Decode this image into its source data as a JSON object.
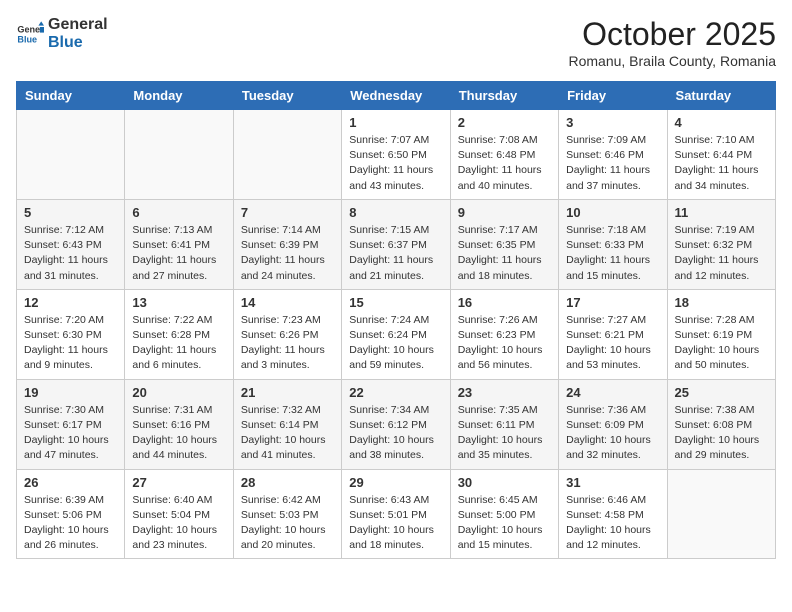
{
  "header": {
    "logo_general": "General",
    "logo_blue": "Blue",
    "month_title": "October 2025",
    "location": "Romanu, Braila County, Romania"
  },
  "weekdays": [
    "Sunday",
    "Monday",
    "Tuesday",
    "Wednesday",
    "Thursday",
    "Friday",
    "Saturday"
  ],
  "weeks": [
    [
      {
        "day": "",
        "info": ""
      },
      {
        "day": "",
        "info": ""
      },
      {
        "day": "",
        "info": ""
      },
      {
        "day": "1",
        "info": "Sunrise: 7:07 AM\nSunset: 6:50 PM\nDaylight: 11 hours\nand 43 minutes."
      },
      {
        "day": "2",
        "info": "Sunrise: 7:08 AM\nSunset: 6:48 PM\nDaylight: 11 hours\nand 40 minutes."
      },
      {
        "day": "3",
        "info": "Sunrise: 7:09 AM\nSunset: 6:46 PM\nDaylight: 11 hours\nand 37 minutes."
      },
      {
        "day": "4",
        "info": "Sunrise: 7:10 AM\nSunset: 6:44 PM\nDaylight: 11 hours\nand 34 minutes."
      }
    ],
    [
      {
        "day": "5",
        "info": "Sunrise: 7:12 AM\nSunset: 6:43 PM\nDaylight: 11 hours\nand 31 minutes."
      },
      {
        "day": "6",
        "info": "Sunrise: 7:13 AM\nSunset: 6:41 PM\nDaylight: 11 hours\nand 27 minutes."
      },
      {
        "day": "7",
        "info": "Sunrise: 7:14 AM\nSunset: 6:39 PM\nDaylight: 11 hours\nand 24 minutes."
      },
      {
        "day": "8",
        "info": "Sunrise: 7:15 AM\nSunset: 6:37 PM\nDaylight: 11 hours\nand 21 minutes."
      },
      {
        "day": "9",
        "info": "Sunrise: 7:17 AM\nSunset: 6:35 PM\nDaylight: 11 hours\nand 18 minutes."
      },
      {
        "day": "10",
        "info": "Sunrise: 7:18 AM\nSunset: 6:33 PM\nDaylight: 11 hours\nand 15 minutes."
      },
      {
        "day": "11",
        "info": "Sunrise: 7:19 AM\nSunset: 6:32 PM\nDaylight: 11 hours\nand 12 minutes."
      }
    ],
    [
      {
        "day": "12",
        "info": "Sunrise: 7:20 AM\nSunset: 6:30 PM\nDaylight: 11 hours\nand 9 minutes."
      },
      {
        "day": "13",
        "info": "Sunrise: 7:22 AM\nSunset: 6:28 PM\nDaylight: 11 hours\nand 6 minutes."
      },
      {
        "day": "14",
        "info": "Sunrise: 7:23 AM\nSunset: 6:26 PM\nDaylight: 11 hours\nand 3 minutes."
      },
      {
        "day": "15",
        "info": "Sunrise: 7:24 AM\nSunset: 6:24 PM\nDaylight: 10 hours\nand 59 minutes."
      },
      {
        "day": "16",
        "info": "Sunrise: 7:26 AM\nSunset: 6:23 PM\nDaylight: 10 hours\nand 56 minutes."
      },
      {
        "day": "17",
        "info": "Sunrise: 7:27 AM\nSunset: 6:21 PM\nDaylight: 10 hours\nand 53 minutes."
      },
      {
        "day": "18",
        "info": "Sunrise: 7:28 AM\nSunset: 6:19 PM\nDaylight: 10 hours\nand 50 minutes."
      }
    ],
    [
      {
        "day": "19",
        "info": "Sunrise: 7:30 AM\nSunset: 6:17 PM\nDaylight: 10 hours\nand 47 minutes."
      },
      {
        "day": "20",
        "info": "Sunrise: 7:31 AM\nSunset: 6:16 PM\nDaylight: 10 hours\nand 44 minutes."
      },
      {
        "day": "21",
        "info": "Sunrise: 7:32 AM\nSunset: 6:14 PM\nDaylight: 10 hours\nand 41 minutes."
      },
      {
        "day": "22",
        "info": "Sunrise: 7:34 AM\nSunset: 6:12 PM\nDaylight: 10 hours\nand 38 minutes."
      },
      {
        "day": "23",
        "info": "Sunrise: 7:35 AM\nSunset: 6:11 PM\nDaylight: 10 hours\nand 35 minutes."
      },
      {
        "day": "24",
        "info": "Sunrise: 7:36 AM\nSunset: 6:09 PM\nDaylight: 10 hours\nand 32 minutes."
      },
      {
        "day": "25",
        "info": "Sunrise: 7:38 AM\nSunset: 6:08 PM\nDaylight: 10 hours\nand 29 minutes."
      }
    ],
    [
      {
        "day": "26",
        "info": "Sunrise: 6:39 AM\nSunset: 5:06 PM\nDaylight: 10 hours\nand 26 minutes."
      },
      {
        "day": "27",
        "info": "Sunrise: 6:40 AM\nSunset: 5:04 PM\nDaylight: 10 hours\nand 23 minutes."
      },
      {
        "day": "28",
        "info": "Sunrise: 6:42 AM\nSunset: 5:03 PM\nDaylight: 10 hours\nand 20 minutes."
      },
      {
        "day": "29",
        "info": "Sunrise: 6:43 AM\nSunset: 5:01 PM\nDaylight: 10 hours\nand 18 minutes."
      },
      {
        "day": "30",
        "info": "Sunrise: 6:45 AM\nSunset: 5:00 PM\nDaylight: 10 hours\nand 15 minutes."
      },
      {
        "day": "31",
        "info": "Sunrise: 6:46 AM\nSunset: 4:58 PM\nDaylight: 10 hours\nand 12 minutes."
      },
      {
        "day": "",
        "info": ""
      }
    ]
  ]
}
